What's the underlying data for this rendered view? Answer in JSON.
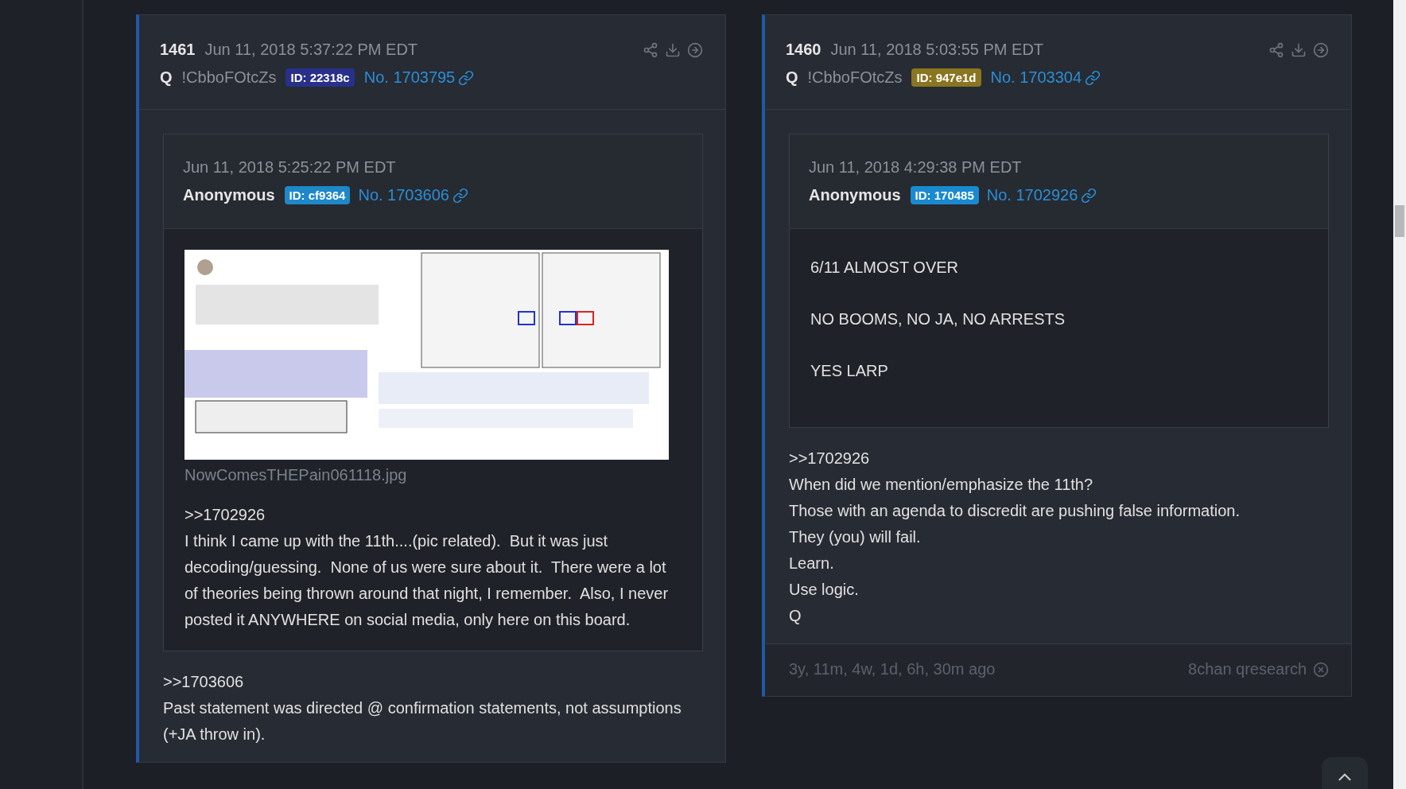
{
  "posts": [
    {
      "number": "1461",
      "timestamp": "Jun 11, 2018 5:37:22 PM EDT",
      "author": "Q",
      "tripcode": "!CbboFOtcZs",
      "id_label": "ID: 22318c",
      "color": "#28308c",
      "post_no": "No. 1703795",
      "quote": {
        "timestamp": "Jun 11, 2018 5:25:22 PM EDT",
        "author": "Anonymous",
        "id_label": "ID: cf9364",
        "color": "#1e88c8",
        "post_no": "No. 1703606",
        "image": {
          "kind": "picture",
          "filename": "NowComesTHEPain061118.jpg"
        },
        "reply_ref": ">>1702926",
        "lines": [
          "I think I came up with the 11th....(pic related).  But it was just decoding/guessing.  None of us were sure about it.  There were a lot of theories being thrown around that night, I remember.  Also, I never posted it ANYWHERE on social media, only here on this board."
        ]
      },
      "reply_ref": ">>1703606",
      "lines": [
        "Past statement was directed @ confirmation statements, not assumptions (+JA throw in)."
      ]
    },
    {
      "number": "1460",
      "timestamp": "Jun 11, 2018 5:03:55 PM EDT",
      "author": "Q",
      "tripcode": "!CbboFOtcZs",
      "id_label": "ID: 947e1d",
      "color": "#8a7520",
      "post_no": "No. 1703304",
      "quote": {
        "timestamp": "Jun 11, 2018 4:29:38 PM EDT",
        "author": "Anonymous",
        "id_label": "ID: 170485",
        "color": "#1a8ad0",
        "post_no": "No. 1702926",
        "paragraphs": [
          "6/11 ALMOST OVER",
          "NO BOOMS, NO JA, NO ARRESTS",
          "YES LARP"
        ]
      },
      "reply_ref": ">>1702926",
      "lines": [
        "When did we mention/emphasize the 11th?",
        "Those with an agenda to discredit are pushing false information.",
        "They (you) will fail.",
        "Learn.",
        "Use logic.",
        "Q"
      ],
      "footer": {
        "age": "3y, 11m, 4w, 1d, 6h, 30m ago",
        "source": "8chan qresearch"
      }
    }
  ]
}
